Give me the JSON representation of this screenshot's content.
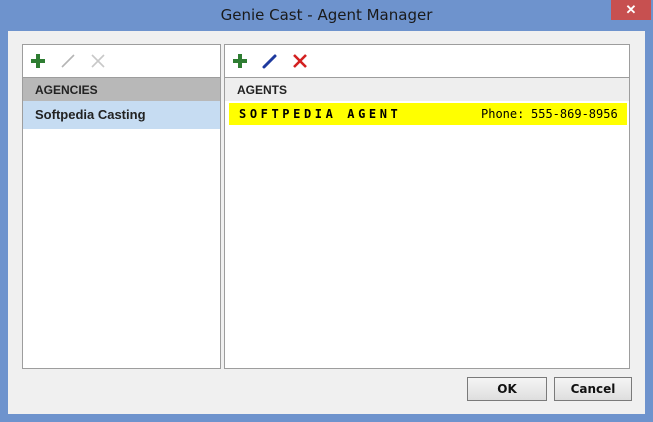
{
  "window": {
    "title": "Genie Cast - Agent Manager",
    "close_symbol": "✕"
  },
  "agencies": {
    "header": "AGENCIES",
    "items": [
      {
        "label": "Softpedia Casting",
        "selected": true
      }
    ],
    "toolbar": {
      "add_icon": "plus-icon",
      "edit_icon": "pencil-icon",
      "delete_icon": "x-icon",
      "edit_enabled": false,
      "delete_enabled": false
    }
  },
  "agents": {
    "header": "AGENTS",
    "items": [
      {
        "name": "SOFTPEDIA AGENT",
        "phone_label": "Phone:",
        "phone": "555-869-8956",
        "highlight": "#ffff00"
      }
    ],
    "toolbar": {
      "add_icon": "plus-icon",
      "edit_icon": "pencil-icon",
      "delete_icon": "x-icon",
      "edit_enabled": true,
      "delete_enabled": true
    }
  },
  "buttons": {
    "ok": "OK",
    "cancel": "Cancel"
  },
  "colors": {
    "titlebar": "#6e93cd",
    "selected_row": "#c6dcf2",
    "agent_highlight": "#ffff00",
    "add_green": "#2e7d32",
    "edit_blue": "#1e3a9e",
    "delete_red": "#d32020"
  }
}
